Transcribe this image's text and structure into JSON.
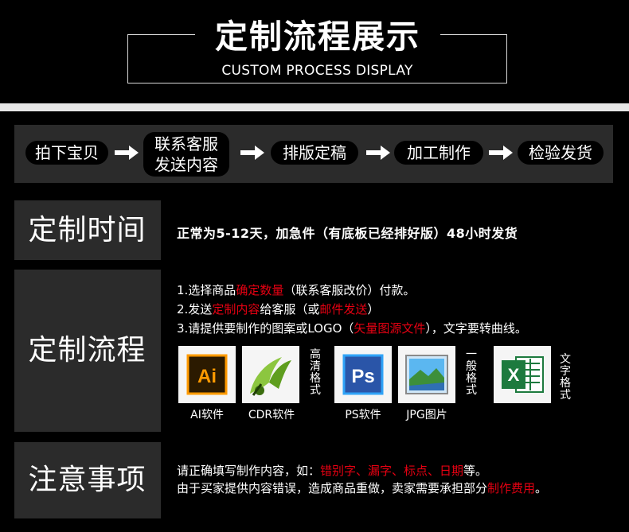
{
  "header": {
    "title": "定制流程展示",
    "subtitle": "CUSTOM PROCESS DISPLAY"
  },
  "flow": {
    "steps": [
      {
        "label": "拍下宝贝"
      },
      {
        "label_line1": "联系客服",
        "label_line2": "发送内容"
      },
      {
        "label": "排版定稿"
      },
      {
        "label": "加工制作"
      },
      {
        "label": "检验发货"
      }
    ],
    "arrow_icon": "arrow-right-icon"
  },
  "time_section": {
    "label": "定制时间",
    "text": "正常为5-12天，加急件（有底板已经排好版）48小时发货"
  },
  "process_section": {
    "label": "定制流程",
    "line1": {
      "prefix": "1.选择商品",
      "red": "确定数量",
      "suffix": "（联系客服改价）付款。"
    },
    "line2": {
      "prefix": "2.发送",
      "red1": "定制内容",
      "middle": "给客服（或",
      "red2": "邮件发送",
      "suffix": "）"
    },
    "line3": {
      "prefix": "3.请提供要制作的图案或LOGO（",
      "red": "矢量图源文件",
      "suffix": "），文字要转曲线。"
    },
    "files": [
      {
        "caption": "AI软件",
        "icon": "illustrator-icon",
        "glyph": "Ai"
      },
      {
        "caption": "CDR软件",
        "icon": "coreldraw-icon"
      },
      {
        "caption": "PS软件",
        "icon": "photoshop-icon",
        "glyph": "Ps"
      },
      {
        "caption": "JPG图片",
        "icon": "jpg-image-icon"
      },
      {
        "caption": "",
        "icon": "excel-icon",
        "glyph": "X"
      }
    ],
    "vertical_notes": [
      "高清格式",
      "一般格式",
      "文字格式"
    ]
  },
  "note_section": {
    "label": "注意事项",
    "line1": {
      "prefix": "请正确填写制作内容，如：",
      "red": "错别字、漏字、标点、日期",
      "suffix": "等。"
    },
    "line2": {
      "prefix": "由于买家提供内容错误，造成商品重做，卖家需要承担部分",
      "red": "制作费用",
      "suffix": "。"
    }
  },
  "colors": {
    "panel": "#2b2b2b",
    "accent_red": "#e60012",
    "ai_orange": "#ff9a00",
    "ps_blue": "#2fa3f7",
    "cdr_green": "#8cc63f",
    "excel_green": "#1d7a3e"
  }
}
